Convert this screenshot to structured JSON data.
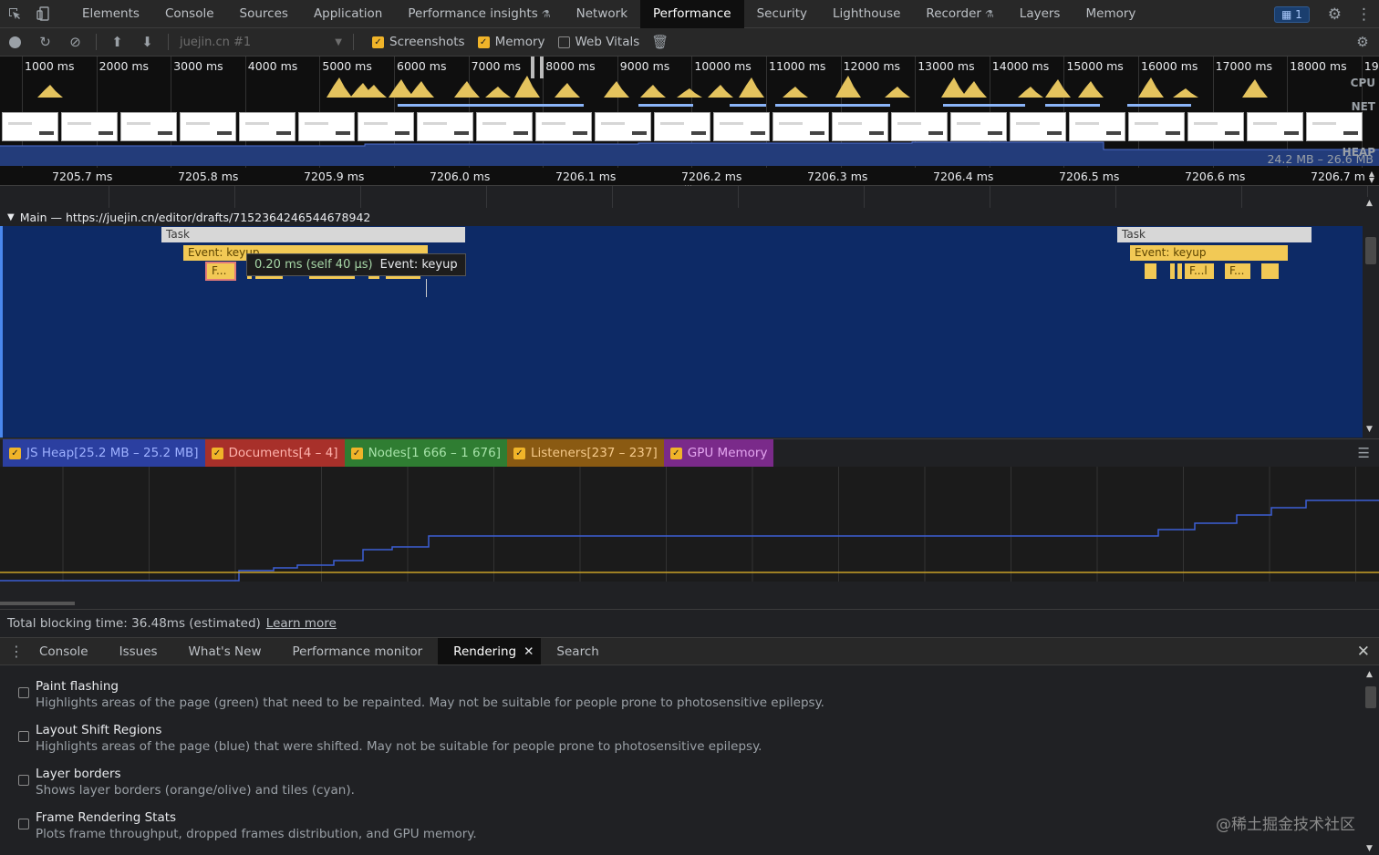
{
  "tabs": [
    {
      "label": "Elements",
      "active": false,
      "flask": false
    },
    {
      "label": "Console",
      "active": false,
      "flask": false
    },
    {
      "label": "Sources",
      "active": false,
      "flask": false
    },
    {
      "label": "Application",
      "active": false,
      "flask": false
    },
    {
      "label": "Performance insights",
      "active": false,
      "flask": true
    },
    {
      "label": "Network",
      "active": false,
      "flask": false
    },
    {
      "label": "Performance",
      "active": true,
      "flask": false
    },
    {
      "label": "Security",
      "active": false,
      "flask": false
    },
    {
      "label": "Lighthouse",
      "active": false,
      "flask": false
    },
    {
      "label": "Recorder",
      "active": false,
      "flask": true
    },
    {
      "label": "Layers",
      "active": false,
      "flask": false
    },
    {
      "label": "Memory",
      "active": false,
      "flask": false
    }
  ],
  "issues_count": "1",
  "toolbar": {
    "profile_select": "juejin.cn #1",
    "screenshots_label": "Screenshots",
    "memory_label": "Memory",
    "web_vitals_label": "Web Vitals"
  },
  "overview": {
    "ticks": [
      "1000 ms",
      "2000 ms",
      "3000 ms",
      "4000 ms",
      "5000 ms",
      "6000 ms",
      "7000 ms",
      "8000 ms",
      "9000 ms",
      "10000 ms",
      "11000 ms",
      "12000 ms",
      "13000 ms",
      "14000 ms",
      "15000 ms",
      "16000 ms",
      "17000 ms",
      "18000 ms",
      "190"
    ],
    "cpu_label": "CPU",
    "net_label": "NET",
    "heap_label": "HEAP",
    "heap_range": "24.2 MB – 26.6 MB"
  },
  "ruler": [
    "7205.7 ms",
    "7205.8 ms",
    "7205.9 ms",
    "7206.0 ms",
    "7206.1 ms",
    "7206.2 ms",
    "7206.3 ms",
    "7206.4 ms",
    "7206.5 ms",
    "7206.6 ms",
    "7206.7 m"
  ],
  "main_thread": {
    "label": "Main — https://juejin.cn/editor/drafts/7152364246544678942",
    "task1": "Task",
    "event1": "Event: keyup",
    "fn1": "F...",
    "task2": "Task",
    "event2": "Event: keyup",
    "fn2a": "F...l",
    "fn2b": "F..."
  },
  "tooltip": {
    "time": "0.20 ms (self 40 μs)",
    "name": "Event: keyup"
  },
  "counters": [
    {
      "label": "JS Heap[25.2 MB – 25.2 MB]",
      "color": "#2b3fa0",
      "text": "#9db0ff"
    },
    {
      "label": "Documents[4 – 4]",
      "color": "#a8302a",
      "text": "#ffb3ad"
    },
    {
      "label": "Nodes[1 666 – 1 676]",
      "color": "#2f7d32",
      "text": "#a6e2a8"
    },
    {
      "label": "Listeners[237 – 237]",
      "color": "#8a5a12",
      "text": "#f5c98a"
    },
    {
      "label": "GPU Memory",
      "color": "#7a2a8a",
      "text": "#e4a6f0"
    }
  ],
  "summary": {
    "text": "Total blocking time: 36.48ms (estimated)",
    "link": "Learn more"
  },
  "drawer_tabs": [
    {
      "label": "Console",
      "active": false
    },
    {
      "label": "Issues",
      "active": false
    },
    {
      "label": "What's New",
      "active": false
    },
    {
      "label": "Performance monitor",
      "active": false
    },
    {
      "label": "Rendering",
      "active": true
    },
    {
      "label": "Search",
      "active": false
    }
  ],
  "rendering_options": [
    {
      "title": "Paint flashing",
      "desc": "Highlights areas of the page (green) that need to be repainted. May not be suitable for people prone to photosensitive epilepsy."
    },
    {
      "title": "Layout Shift Regions",
      "desc": "Highlights areas of the page (blue) that were shifted. May not be suitable for people prone to photosensitive epilepsy."
    },
    {
      "title": "Layer borders",
      "desc": "Shows layer borders (orange/olive) and tiles (cyan)."
    },
    {
      "title": "Frame Rendering Stats",
      "desc": "Plots frame throughput, dropped frames distribution, and GPU memory."
    }
  ],
  "watermark": "@稀土掘金技术社区"
}
